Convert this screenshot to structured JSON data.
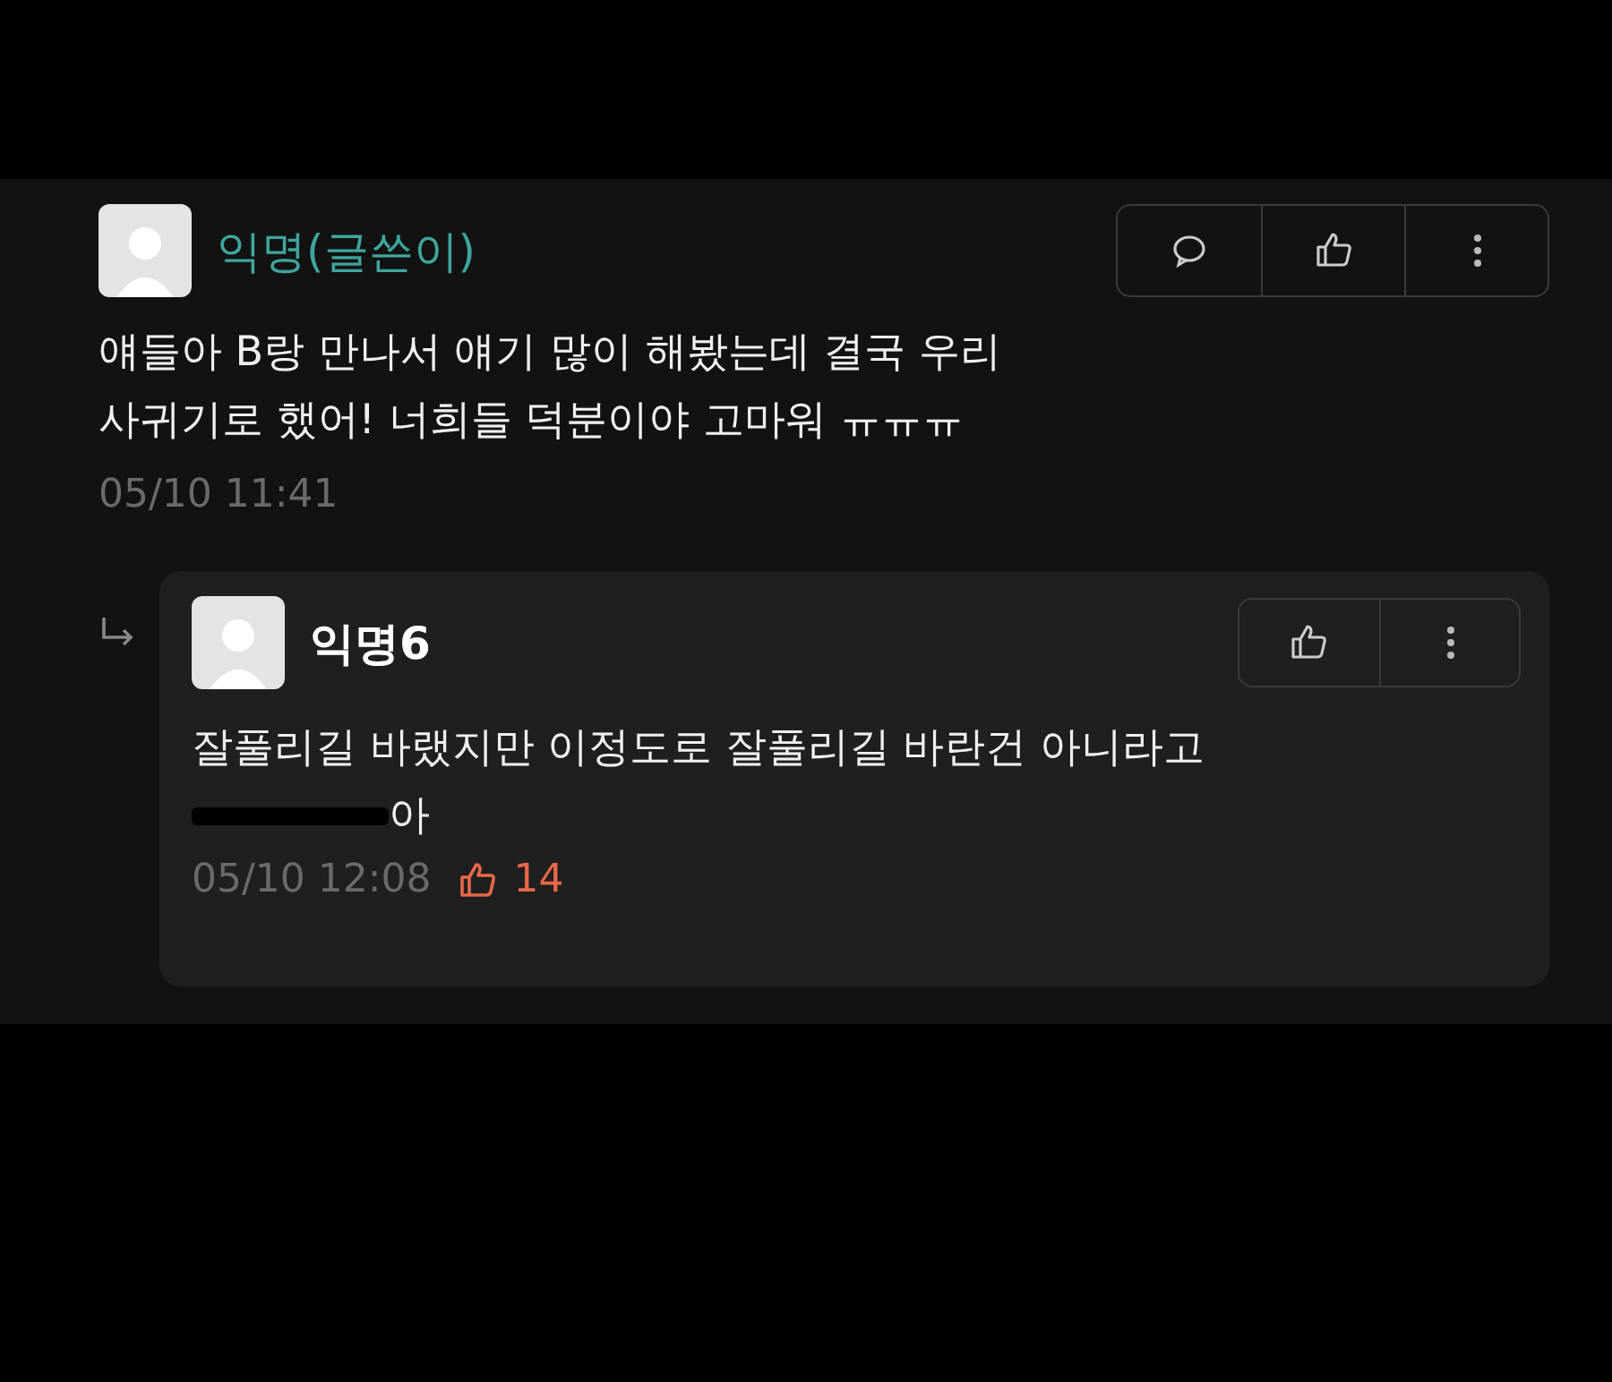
{
  "post": {
    "author": "익명(글쓴이)",
    "body": "얘들아 B랑 만나서 얘기 많이 해봤는데 결국 우리\n사귀기로 했어! 너희들 덕분이야 고마워 ㅠㅠㅠ",
    "time": "05/10 11:41",
    "actions": [
      {
        "kind": "comment"
      },
      {
        "kind": "like"
      },
      {
        "kind": "more"
      }
    ]
  },
  "reply": {
    "author": "익명6",
    "body": "잘풀리길 바랬지만 이정도로 잘풀리길 바란건 아니라고",
    "censored": true,
    "tail": "아",
    "time": "05/10 12:08",
    "likes": "14",
    "actions": [
      {
        "kind": "like"
      },
      {
        "kind": "more"
      }
    ]
  }
}
